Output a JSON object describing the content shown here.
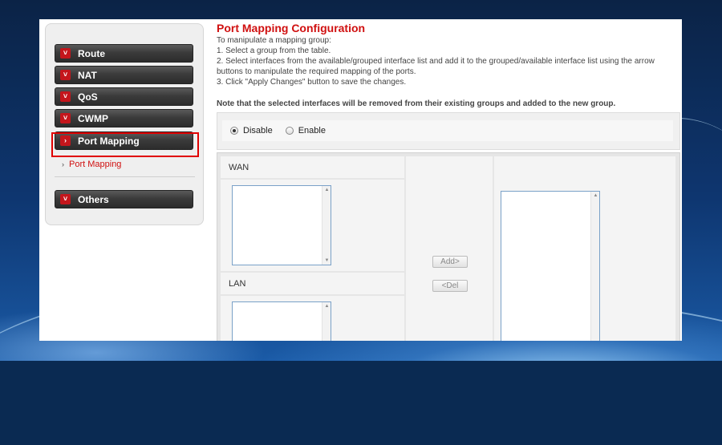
{
  "sidebar": {
    "items": [
      {
        "label": "Route"
      },
      {
        "label": "NAT"
      },
      {
        "label": "QoS"
      },
      {
        "label": "CWMP"
      },
      {
        "label": "Port Mapping"
      },
      {
        "label": "Others"
      }
    ],
    "subitems": [
      {
        "label": "Port Mapping"
      }
    ]
  },
  "main": {
    "title": "Port Mapping Configuration",
    "instructions": [
      "To manipulate a mapping group:",
      "1. Select a group from the table.",
      "2. Select interfaces from the available/grouped interface list and add it to the grouped/available interface list using the arrow buttons to manipulate the required mapping of the ports.",
      "3. Click \"Apply Changes\" button to save the changes."
    ],
    "note": "Note that the selected interfaces will be removed from their existing groups and added to the new group.",
    "mode": {
      "options": [
        {
          "label": "Disable",
          "checked": true
        },
        {
          "label": "Enable",
          "checked": false
        }
      ]
    },
    "mapping": {
      "wan_label": "WAN",
      "lan_label": "LAN",
      "add_button": "Add>",
      "del_button": "<Del"
    }
  },
  "colors": {
    "accent": "#d01010",
    "highlight_border": "#e00000"
  }
}
